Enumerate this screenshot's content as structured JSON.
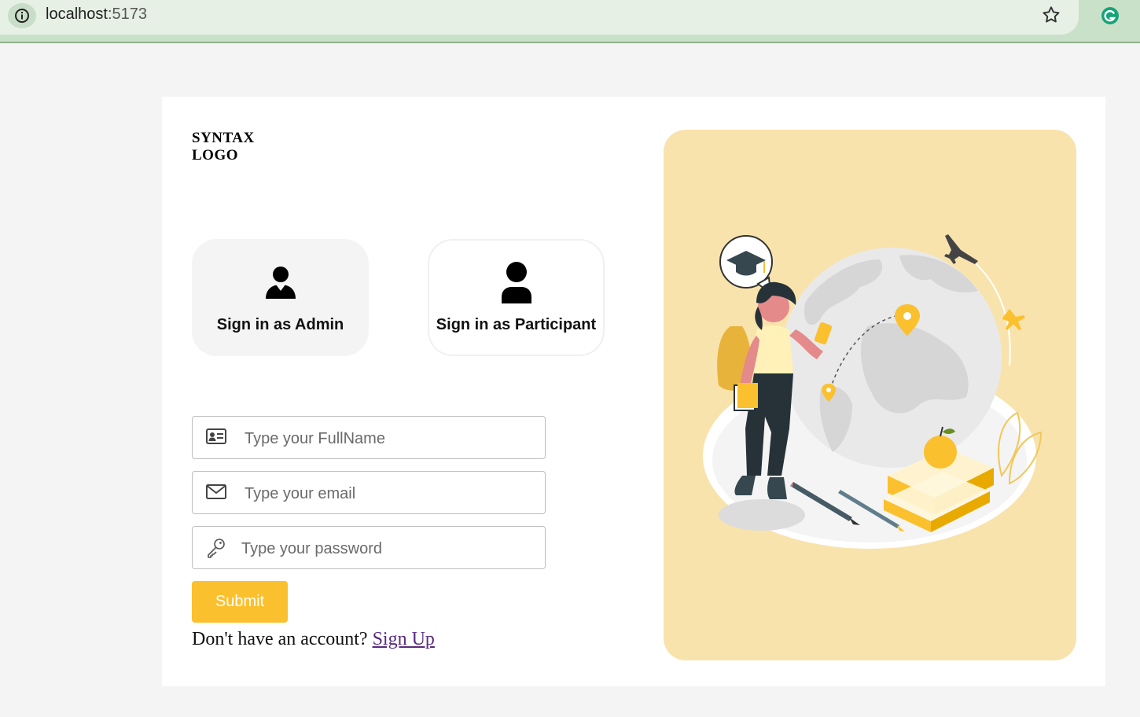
{
  "browser": {
    "url_host": "localhost",
    "url_port": ":5173"
  },
  "logo": {
    "line1": "SYNTAX",
    "line2": "LOGO"
  },
  "roles": {
    "admin_label": "Sign in as Admin",
    "participant_label": "Sign in as Participant"
  },
  "form": {
    "fullname_placeholder": "Type your FullName",
    "email_placeholder": "Type your email",
    "password_placeholder": "Type your password",
    "submit_label": "Submit"
  },
  "signup": {
    "prompt": "Don't have an account?",
    "link": "Sign Up"
  },
  "colors": {
    "accent": "#fbc02d",
    "illustration_bg": "#f9e3ad",
    "link": "#5a2a82"
  }
}
